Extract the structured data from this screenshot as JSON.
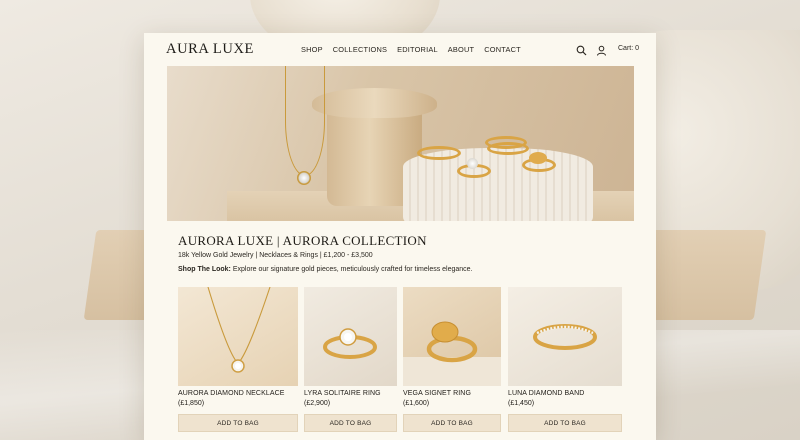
{
  "brand": {
    "logo": "AURA LUXE"
  },
  "nav": {
    "items": [
      "SHOP",
      "COLLECTIONS",
      "EDITORIAL",
      "ABOUT",
      "CONTACT"
    ],
    "cart_label": "Cart: 0",
    "icons": [
      "search-icon",
      "user-icon"
    ]
  },
  "hero": {
    "alt": ""
  },
  "collection": {
    "title": "AURORA LUXE | AURORA COLLECTION",
    "subtitle": "18k Yellow Gold Jewelry | Necklaces & Rings | £1,200 - £3,500",
    "tagline_bold": "Shop The Look:",
    "tagline_text": " Explore our signature gold pieces, meticulously crafted for timeless elegance."
  },
  "products": [
    {
      "name": "AURORA DIAMOND NECKLACE",
      "price": "(£1,850)",
      "button": "ADD TO BAG"
    },
    {
      "name": "LYRA SOLITAIRE RING",
      "price": "(£2,900)",
      "button": "ADD TO BAG"
    },
    {
      "name": "VEGA SIGNET RING",
      "price": "(£1,600)",
      "button": "ADD TO BAG"
    },
    {
      "name": "LUNA DIAMOND BAND",
      "price": "(£1,450)",
      "button": "ADD TO BAG"
    }
  ],
  "colors": {
    "page_bg": "#fbf8ef",
    "gold": "#d9a445",
    "button_bg": "#efe3cf",
    "text": "#1f1c17"
  }
}
